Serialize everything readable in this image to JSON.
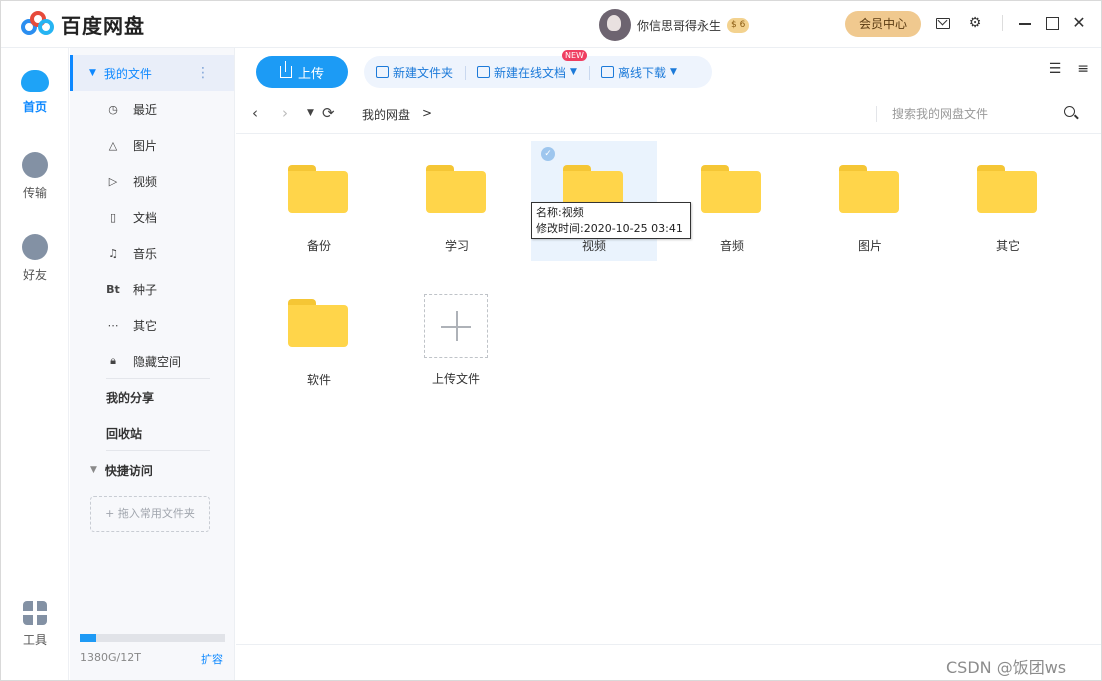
{
  "app": {
    "title": "百度网盘",
    "brand_color": "#1c9bf5"
  },
  "header": {
    "username": "你信思哥得永生",
    "coin_badge": "$ 6",
    "vip_label": "会员中心"
  },
  "left_nav": [
    {
      "label": "首页",
      "icon": "cloud-icon",
      "active": true
    },
    {
      "label": "传输",
      "icon": "transfer-icon"
    },
    {
      "label": "好友",
      "icon": "friends-icon"
    },
    {
      "label": "工具",
      "icon": "tools-icon"
    }
  ],
  "sidebar": {
    "my_files": "我的文件",
    "sub_items": [
      {
        "label": "最近",
        "icon": "clock-icon"
      },
      {
        "label": "图片",
        "icon": "image-icon"
      },
      {
        "label": "视频",
        "icon": "play-icon"
      },
      {
        "label": "文档",
        "icon": "document-icon"
      },
      {
        "label": "音乐",
        "icon": "headphones-icon"
      },
      {
        "label": "种子",
        "icon": "bt-icon",
        "glyph": "Bt"
      },
      {
        "label": "其它",
        "icon": "more-icon"
      },
      {
        "label": "隐藏空间",
        "icon": "lock-icon"
      }
    ],
    "my_share": "我的分享",
    "recycle": "回收站",
    "quick_access": "快捷访问",
    "quick_add_hint": "+ 拖入常用文件夹",
    "storage": {
      "used_text": "1380G/12T",
      "fraction": 0.11
    },
    "expand_label": "扩容"
  },
  "toolbar": {
    "upload": "上传",
    "new_folder": "新建文件夹",
    "new_online_doc": "新建在线文档",
    "new_badge": "NEW",
    "offline_download": "离线下载"
  },
  "navbar": {
    "breadcrumb": "我的网盘",
    "breadcrumb_sep": ">",
    "search_placeholder": "搜索我的网盘文件"
  },
  "files": [
    {
      "name": "备份"
    },
    {
      "name": "学习"
    },
    {
      "name": "视频",
      "selected": true
    },
    {
      "name": "音频"
    },
    {
      "name": "图片"
    },
    {
      "name": "其它"
    },
    {
      "name": "软件"
    }
  ],
  "upload_tile_label": "上传文件",
  "tooltip": {
    "name_line": "名称:视频",
    "time_line": "修改时间:2020-10-25 03:41"
  },
  "watermark": "CSDN @饭团ws"
}
